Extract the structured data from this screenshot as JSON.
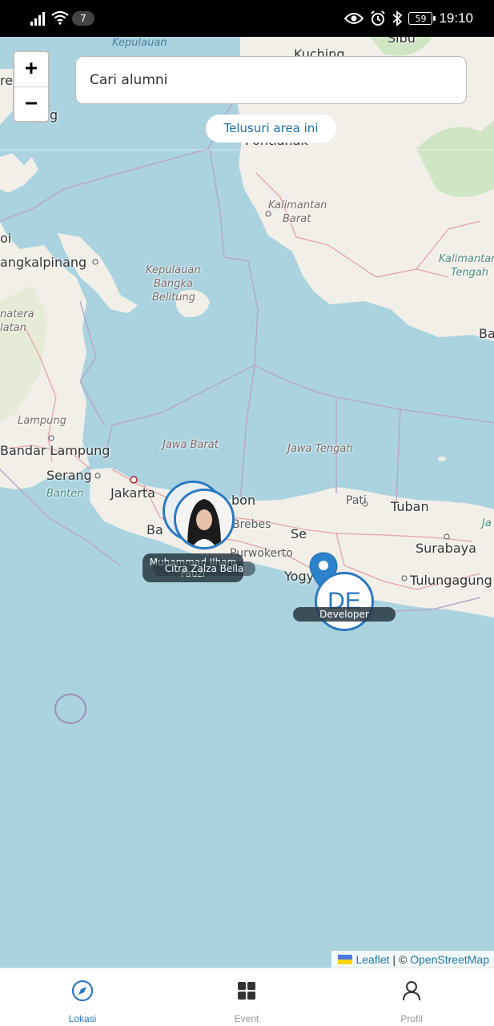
{
  "status_bar": {
    "notification_count": "7",
    "battery": "59",
    "time": "19:10"
  },
  "map": {
    "zoom_in_label": "+",
    "zoom_out_label": "−",
    "search": {
      "placeholder": "Cari alumni",
      "value": ""
    },
    "explore_area_label": "Telusuri area ini",
    "labels": {
      "kepulauan_top": "Kepulauan",
      "kuching": "Kuching",
      "sibu": "Sibu",
      "pontianak": "Pontianak",
      "kalimantan_barat_1": "Kalimantan",
      "kalimantan_barat_2": "Barat",
      "kalimantan_tengah_1": "Kalimantan",
      "kalimantan_tengah_2": "Tengah",
      "pangkalpinang": "angkalpinang",
      "kep_bangka_1": "Kepulauan",
      "kep_bangka_2": "Bangka",
      "kep_bangka_3": "Belitung",
      "sumatera_1": "natera",
      "sumatera_2": "latan",
      "lampung": "Lampung",
      "bandar_lampung": "Bandar Lampung",
      "jawa_barat": "Jawa Barat",
      "jawa_tengah": "Jawa Tengah",
      "serang": "Serang",
      "banten": "Banten",
      "jakarta": "Jakarta",
      "bandung": "Ba",
      "cirebon": "bon",
      "brebes": "Brebes",
      "purwokerto": "Purwokerto",
      "semarang": "Se",
      "pati": "Pati",
      "tuban": "Tuban",
      "surabaya": "Surabaya",
      "tulungagung": "Tulungagung",
      "yogyakarta": "Yogy",
      "ba_right": "Ba",
      "jawa_timur": "Ja",
      "g_left": "g",
      "re_left": "re",
      "oi_left": "oi"
    },
    "markers": [
      {
        "label_1": "Muhammad Ilham",
        "label_2": "Fauzi"
      },
      {
        "label_1": "Citra Zalza Bella"
      },
      {
        "label_1": "DE",
        "caption": "Developer"
      }
    ],
    "attribution": {
      "leaflet": "Leaflet",
      "separator": "| ©",
      "osm": "OpenStreetMap"
    }
  },
  "bottom_nav": [
    {
      "label": "Lokasi",
      "icon": "compass-icon",
      "active": true
    },
    {
      "label": "Event",
      "icon": "grid-icon",
      "active": false
    },
    {
      "label": "Profil",
      "icon": "person-icon",
      "active": false
    }
  ],
  "colors": {
    "accent": "#2b78c2",
    "sea": "#aad3df",
    "land": "#f2efe9"
  }
}
